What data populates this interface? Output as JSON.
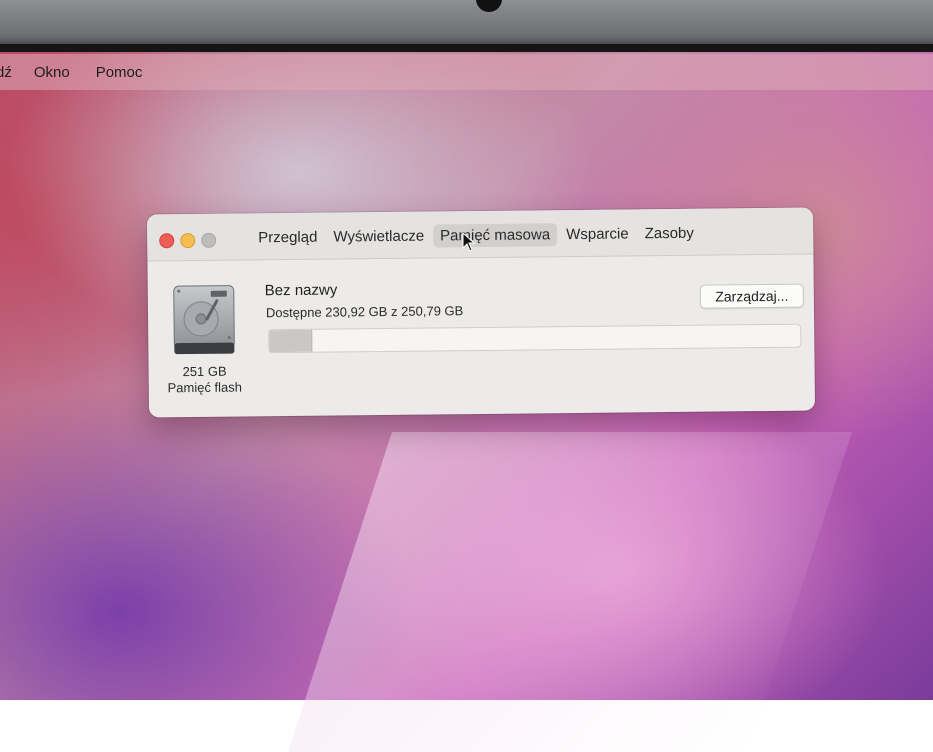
{
  "menubar": {
    "items": [
      "dź",
      "Okno",
      "Pomoc"
    ]
  },
  "window": {
    "tabs": [
      {
        "label": "Przegląd",
        "active": false
      },
      {
        "label": "Wyświetlacze",
        "active": false
      },
      {
        "label": "Pamięć masowa",
        "active": true
      },
      {
        "label": "Wsparcie",
        "active": false
      },
      {
        "label": "Zasoby",
        "active": false
      }
    ],
    "disk": {
      "size": "251 GB",
      "type": "Pamięć flash",
      "volume_name": "Bez nazwy",
      "availability": "Dostępne 230,92 GB z 250,79 GB",
      "used_fraction": 0.079,
      "manage_label": "Zarządzaj..."
    }
  },
  "colors": {
    "close": "#ee5e56",
    "minimize": "#f5bd4f",
    "zoom": "#bdbdbd"
  }
}
